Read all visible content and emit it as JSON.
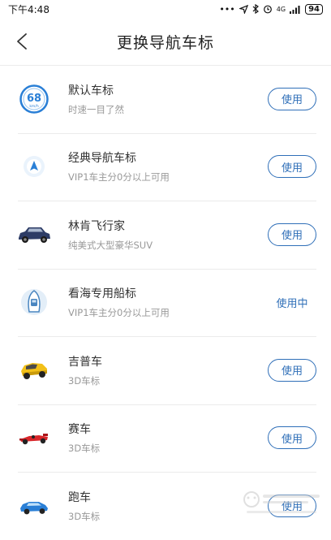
{
  "status_bar": {
    "time": "下午4:48",
    "icons": [
      "dots-icon",
      "location-icon",
      "bluetooth-icon",
      "alarm-icon",
      "signal-icon"
    ],
    "network": "4G",
    "battery": "94"
  },
  "header": {
    "title": "更换导航车标"
  },
  "items": [
    {
      "name": "默认车标",
      "desc": "时速一目了然",
      "action": "使用",
      "active": false,
      "icon": "speedometer-icon",
      "speed": "68",
      "unit": "km/h"
    },
    {
      "name": "经典导航车标",
      "desc": "VIP1车主分0分以上可用",
      "action": "使用",
      "active": false,
      "icon": "navigation-arrow-icon"
    },
    {
      "name": "林肯飞行家",
      "desc": "纯美式大型豪华SUV",
      "action": "使用",
      "active": false,
      "icon": "suv-car-icon"
    },
    {
      "name": "看海专用船标",
      "desc": "VIP1车主分0分以上可用",
      "action": "使用中",
      "active": true,
      "icon": "boat-icon"
    },
    {
      "name": "吉普车",
      "desc": "3D车标",
      "action": "使用",
      "active": false,
      "icon": "jeep-icon"
    },
    {
      "name": "赛车",
      "desc": "3D车标",
      "action": "使用",
      "active": false,
      "icon": "race-car-icon"
    },
    {
      "name": "跑车",
      "desc": "3D车标",
      "action": "使用",
      "active": false,
      "icon": "sports-car-icon"
    }
  ],
  "colors": {
    "accent": "#2f6fb8",
    "speed_ring": "#2a7fd6",
    "jeep": "#f2c018",
    "race_car": "#d8262a",
    "sports_car": "#2a7fd6",
    "suv": "#2d3c66"
  }
}
